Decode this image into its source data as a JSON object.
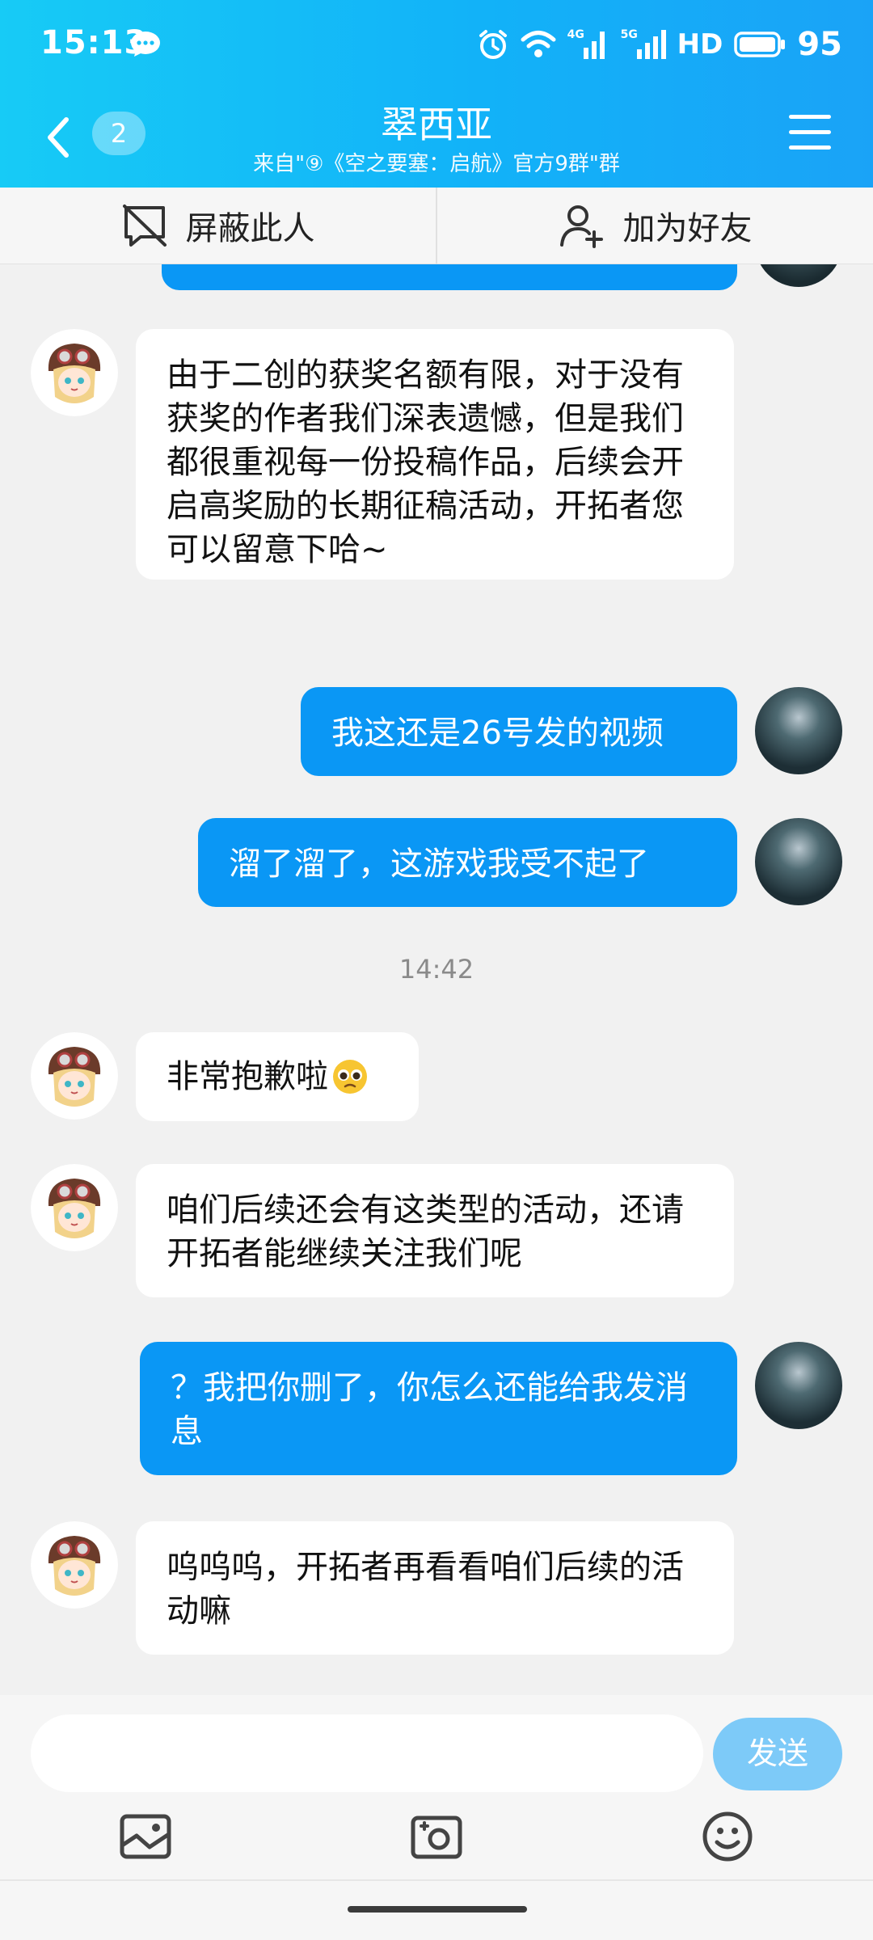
{
  "status_bar": {
    "time": "15:13",
    "battery": "95",
    "network_4g": "4G",
    "network_5g": "5G",
    "hd": "HD"
  },
  "header": {
    "back_count": "2",
    "title": "翠西亚",
    "subtitle": "来自\"⑨《空之要塞：启航》官方9群\"群"
  },
  "actions": {
    "block_label": "屏蔽此人",
    "add_friend_label": "加为好友"
  },
  "messages": [
    {
      "side": "in",
      "text": "由于二创的获奖名额有限，对于没有获奖的作者我们深表遗憾，但是我们都很重视每一份投稿作品，后续会开启高奖励的长期征稿活动，开拓者您可以留意下哈~"
    },
    {
      "side": "out",
      "text": "我这还是26号发的视频"
    },
    {
      "side": "out",
      "text": "溜了溜了，这游戏我受不起了"
    },
    {
      "side": "in",
      "text": "非常抱歉啦"
    },
    {
      "side": "in",
      "text": "咱们后续还会有这类型的活动，还请开拓者能继续关注我们呢"
    },
    {
      "side": "out",
      "text": "？我把你删了，你怎么还能给我发消息"
    },
    {
      "side": "in",
      "text": "呜呜呜，开拓者再看看咱们后续的活动嘛"
    }
  ],
  "timestamp": "14:42",
  "input": {
    "placeholder": "",
    "send_label": "发送"
  },
  "colors": {
    "header_gradient_start": "#17cbf6",
    "header_gradient_end": "#1aa3f7",
    "outgoing_bubble": "#0a97f5",
    "send_button": "#7dcaf8"
  },
  "icons": [
    "chat-bubble-icon",
    "alarm-icon",
    "wifi-icon",
    "signal-icon",
    "battery-icon",
    "back-chevron-icon",
    "menu-icon",
    "block-icon",
    "add-friend-icon",
    "image-icon",
    "camera-icon",
    "emoji-icon",
    "pleading-emoji-icon"
  ]
}
